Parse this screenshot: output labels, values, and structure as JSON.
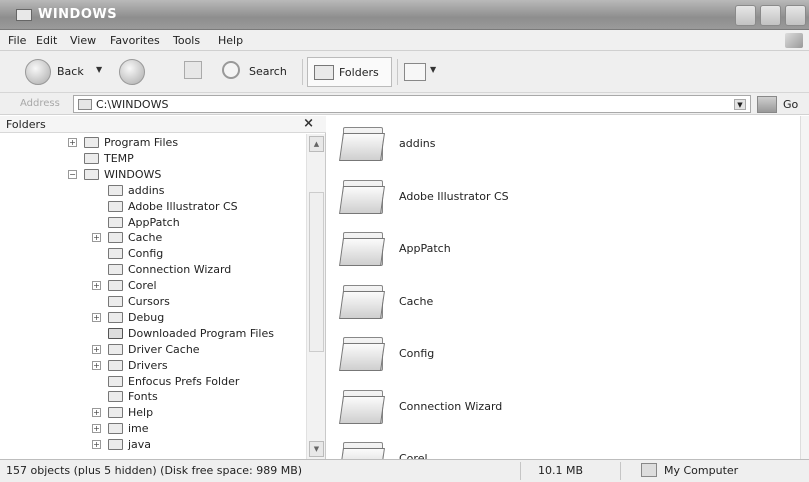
{
  "window": {
    "title": "WINDOWS"
  },
  "menu": {
    "items": [
      "File",
      "Edit",
      "View",
      "Favorites",
      "Tools",
      "Help"
    ]
  },
  "toolbar": {
    "back_label": "Back",
    "search_label": "Search",
    "folders_label": "Folders"
  },
  "address": {
    "label": "Address",
    "value": "C:\\WINDOWS",
    "go_label": "Go"
  },
  "folders_pane": {
    "title": "Folders",
    "close_glyph": "×",
    "items": [
      {
        "label": "Program Files",
        "expander": "+",
        "kind": "folder"
      },
      {
        "label": "TEMP",
        "expander": "",
        "kind": "folder"
      },
      {
        "label": "WINDOWS",
        "expander": "−",
        "kind": "folder"
      },
      {
        "label": "addins",
        "expander": "",
        "kind": "folder"
      },
      {
        "label": "Adobe Illustrator CS",
        "expander": "",
        "kind": "folder"
      },
      {
        "label": "AppPatch",
        "expander": "",
        "kind": "folder"
      },
      {
        "label": "Cache",
        "expander": "+",
        "kind": "folder"
      },
      {
        "label": "Config",
        "expander": "",
        "kind": "folder"
      },
      {
        "label": "Connection Wizard",
        "expander": "",
        "kind": "folder"
      },
      {
        "label": "Corel",
        "expander": "+",
        "kind": "folder"
      },
      {
        "label": "Cursors",
        "expander": "",
        "kind": "folder"
      },
      {
        "label": "Debug",
        "expander": "+",
        "kind": "folder"
      },
      {
        "label": "Downloaded Program Files",
        "expander": "",
        "kind": "special"
      },
      {
        "label": "Driver Cache",
        "expander": "+",
        "kind": "folder"
      },
      {
        "label": "Drivers",
        "expander": "+",
        "kind": "folder"
      },
      {
        "label": "Enfocus Prefs Folder",
        "expander": "",
        "kind": "folder"
      },
      {
        "label": "Fonts",
        "expander": "",
        "kind": "folder"
      },
      {
        "label": "Help",
        "expander": "+",
        "kind": "folder"
      },
      {
        "label": "ime",
        "expander": "+",
        "kind": "folder"
      },
      {
        "label": "java",
        "expander": "+",
        "kind": "folder"
      }
    ]
  },
  "content": {
    "items": [
      "addins",
      "Adobe Illustrator CS",
      "AppPatch",
      "Cache",
      "Config",
      "Connection Wizard",
      "Corel"
    ]
  },
  "status": {
    "objects": "157 objects (plus 5 hidden) (Disk free space: 989 MB)",
    "size": "10.1 MB",
    "location": "My Computer"
  },
  "icons": {
    "window": "folder-icon",
    "back": "back-arrow-icon",
    "forward": "forward-arrow-icon",
    "up": "up-folder-icon",
    "search": "search-icon",
    "folders": "folders-icon",
    "views": "views-icon",
    "go": "go-arrow-icon",
    "computer": "computer-icon"
  }
}
